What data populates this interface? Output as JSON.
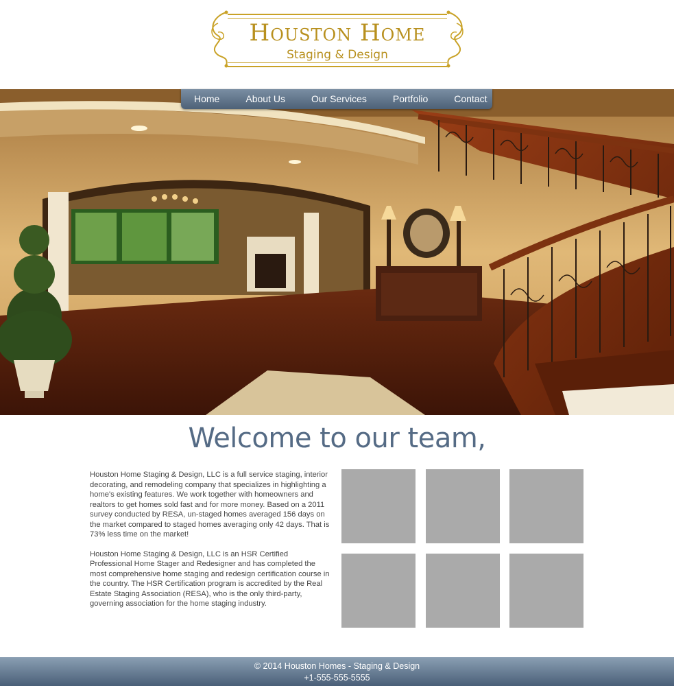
{
  "logo": {
    "title": "Houston Home",
    "subtitle": "Staging & Design",
    "color": "#b8901e"
  },
  "nav": {
    "items": [
      "Home",
      "About Us",
      "Our Services",
      "Portfolio",
      "Contact"
    ]
  },
  "welcome": {
    "heading": "Welcome to our team,",
    "paragraphs": [
      "Houston Home Staging & Design, LLC is a full service staging, interior decorating, and remodeling company that specializes in highlighting a home's existing features.  We work together with homeowners and realtors to get homes sold fast and for more money.  Based on a 2011 survey conducted by RESA, un-staged homes averaged 156 days on the market compared to staged homes averaging only 42 days.  That is 73% less time on the market!",
      "Houston Home Staging & Design, LLC is an HSR Certified Professional Home Stager and Redesigner and has completed the most comprehensive home staging and redesign certification course in the country.  The HSR Certification program is accredited by the Real Estate Staging Association (RESA), who is the only third-party, governing association for the home staging industry."
    ]
  },
  "footer": {
    "copyright": "© 2014 Houston Homes - Staging & Design",
    "phone": "+1-555-555-5555"
  },
  "colors": {
    "nav": "#5c7088",
    "heading": "#556b85",
    "placeholder_tile": "#aaaaaa"
  }
}
